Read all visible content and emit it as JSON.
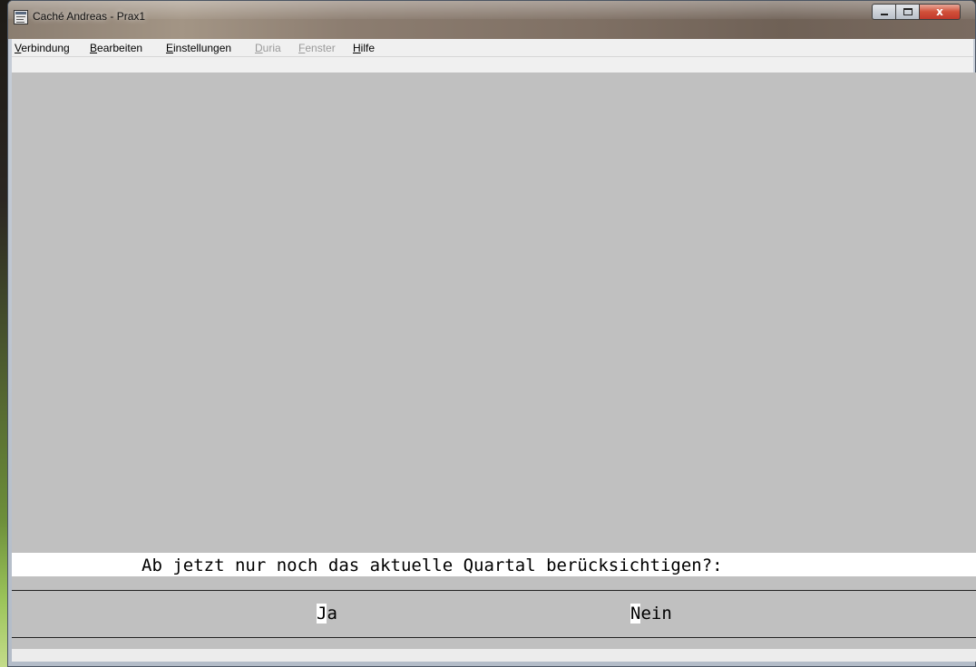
{
  "window": {
    "title": "Caché Andreas - Prax1",
    "close_glyph": "x"
  },
  "menu": {
    "items": [
      {
        "mnemonic": "V",
        "rest": "erbindung",
        "enabled": true
      },
      {
        "mnemonic": "B",
        "rest": "earbeiten",
        "enabled": true
      },
      {
        "mnemonic": "E",
        "rest": "instellungen",
        "enabled": true
      },
      {
        "mnemonic": "D",
        "rest": "uria",
        "enabled": false
      },
      {
        "mnemonic": "F",
        "rest": "enster",
        "enabled": false
      },
      {
        "mnemonic": "H",
        "rest": "ilfe",
        "enabled": true
      }
    ]
  },
  "terminal": {
    "question": "Ab jetzt nur noch das aktuelle Quartal berücksichtigen?:",
    "options": [
      {
        "hotkey": "J",
        "rest": "a"
      },
      {
        "hotkey": "N",
        "rest": "ein"
      }
    ]
  }
}
